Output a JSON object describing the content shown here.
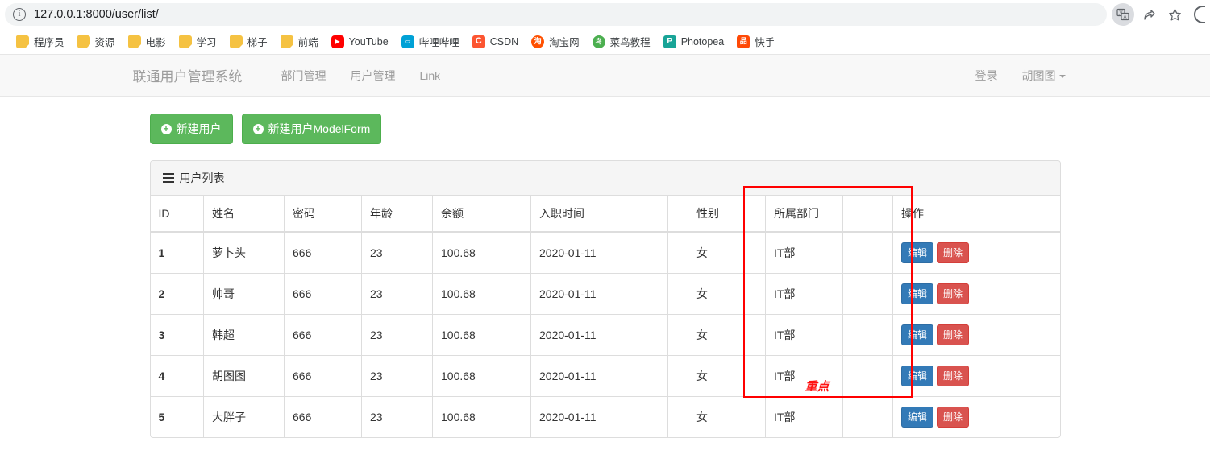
{
  "browser": {
    "url": "127.0.0.1:8000/user/list/",
    "info_icon": "info-icon",
    "translate_icon": "translate-icon",
    "share_icon": "share-icon",
    "bookmark_star_icon": "star-icon",
    "bookmarks": [
      {
        "label": "程序员",
        "icon": "folder-icon",
        "glyph": "",
        "kind": "folder"
      },
      {
        "label": "资源",
        "icon": "folder-icon",
        "glyph": "",
        "kind": "folder"
      },
      {
        "label": "电影",
        "icon": "folder-icon",
        "glyph": "",
        "kind": "folder"
      },
      {
        "label": "学习",
        "icon": "folder-icon",
        "glyph": "",
        "kind": "folder"
      },
      {
        "label": "梯子",
        "icon": "folder-icon",
        "glyph": "",
        "kind": "folder"
      },
      {
        "label": "前端",
        "icon": "folder-icon",
        "glyph": "",
        "kind": "folder"
      },
      {
        "label": "YouTube",
        "icon": "youtube-icon",
        "glyph": "▶",
        "kind": "youtube"
      },
      {
        "label": "哔哩哔哩",
        "icon": "bilibili-icon",
        "glyph": "▱",
        "kind": "bili"
      },
      {
        "label": "CSDN",
        "icon": "csdn-icon",
        "glyph": "C",
        "kind": "csdn"
      },
      {
        "label": "淘宝网",
        "icon": "taobao-icon",
        "glyph": "淘",
        "kind": "taobao"
      },
      {
        "label": "菜鸟教程",
        "icon": "runoob-icon",
        "glyph": "鸟",
        "kind": "runoob"
      },
      {
        "label": "Photopea",
        "icon": "photopea-icon",
        "glyph": "P",
        "kind": "photopea"
      },
      {
        "label": "快手",
        "icon": "kuaishou-icon",
        "glyph": "品",
        "kind": "kuaishou"
      }
    ]
  },
  "navbar": {
    "brand": "联通用户管理系统",
    "links": [
      "部门管理",
      "用户管理",
      "Link"
    ],
    "login": "登录",
    "user": "胡图图",
    "caret_icon": "caret-down-icon"
  },
  "toolbar": {
    "buttons": [
      {
        "label": "新建用户",
        "icon": "plus-circle-icon",
        "style": "success"
      },
      {
        "label": "新建用户ModelForm",
        "icon": "plus-circle-icon",
        "style": "success"
      }
    ]
  },
  "panel": {
    "heading": "用户列表",
    "heading_icon": "th-list-icon"
  },
  "table": {
    "columns": [
      "ID",
      "姓名",
      "密码",
      "年龄",
      "余额",
      "入职时间",
      "",
      "性别",
      "所属部门",
      "",
      "操作"
    ],
    "rows": [
      {
        "id": "1",
        "name": "萝卜头",
        "password": "666",
        "age": "23",
        "balance": "100.68",
        "hire_date": "2020-01-11",
        "gap1": "",
        "gender": "女",
        "department": "IT部",
        "gap2": ""
      },
      {
        "id": "2",
        "name": "帅哥",
        "password": "666",
        "age": "23",
        "balance": "100.68",
        "hire_date": "2020-01-11",
        "gap1": "",
        "gender": "女",
        "department": "IT部",
        "gap2": ""
      },
      {
        "id": "3",
        "name": "韩超",
        "password": "666",
        "age": "23",
        "balance": "100.68",
        "hire_date": "2020-01-11",
        "gap1": "",
        "gender": "女",
        "department": "IT部",
        "gap2": ""
      },
      {
        "id": "4",
        "name": "胡图图",
        "password": "666",
        "age": "23",
        "balance": "100.68",
        "hire_date": "2020-01-11",
        "gap1": "",
        "gender": "女",
        "department": "IT部",
        "gap2": ""
      },
      {
        "id": "5",
        "name": "大胖子",
        "password": "666",
        "age": "23",
        "balance": "100.68",
        "hire_date": "2020-01-11",
        "gap1": "",
        "gender": "女",
        "department": "IT部",
        "gap2": ""
      }
    ],
    "row_actions": {
      "edit": "编辑",
      "delete": "删除"
    }
  },
  "annotation": {
    "label": "重点",
    "color": "#ff0000"
  },
  "colors": {
    "success": "#5cb85c",
    "primary": "#337ab7",
    "danger": "#d9534f",
    "navbar_bg": "#f8f8f8",
    "panel_head_bg": "#f5f5f5",
    "annotation_red": "#ff0000"
  }
}
